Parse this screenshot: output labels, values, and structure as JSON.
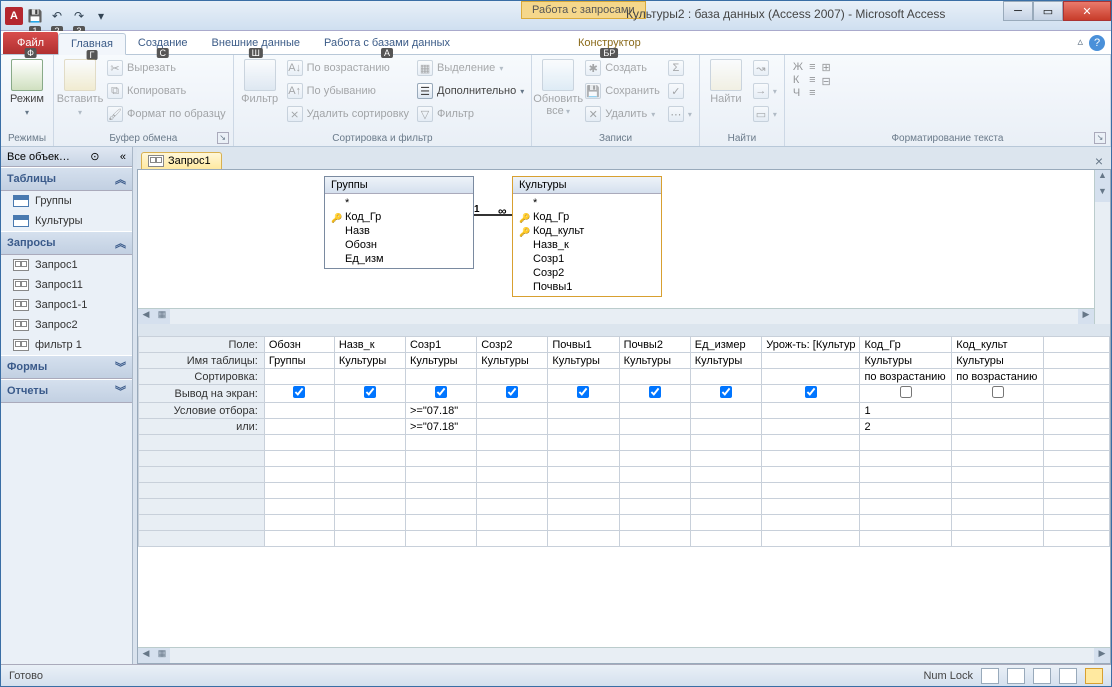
{
  "titlebar": {
    "context_tab": "Работа с запросами",
    "title": "Культуры2 : база данных (Access 2007)  -  Microsoft Access"
  },
  "qat_keytips": [
    "1",
    "2",
    "3"
  ],
  "ribbon_tabs": {
    "file": "Файл",
    "tabs": [
      {
        "label": "Главная",
        "key": "Г",
        "active": true
      },
      {
        "label": "Создание",
        "key": "С"
      },
      {
        "label": "Внешние данные",
        "key": "Ш"
      },
      {
        "label": "Работа с базами данных",
        "key": "А"
      },
      {
        "label": "Конструктор",
        "key": "БР",
        "context": true
      }
    ],
    "file_key": "Ф"
  },
  "ribbon": {
    "views": {
      "mode": "Режим",
      "group": "Режимы"
    },
    "clipboard": {
      "paste": "Вставить",
      "cut": "Вырезать",
      "copy": "Копировать",
      "fmt": "Формат по образцу",
      "group": "Буфер обмена"
    },
    "sort": {
      "filter": "Фильтр",
      "asc": "По возрастанию",
      "desc": "По убыванию",
      "clear": "Удалить сортировку",
      "sel": "Выделение",
      "adv": "Дополнительно",
      "toggle": "Фильтр",
      "group": "Сортировка и фильтр"
    },
    "records": {
      "refresh": "Обновить все",
      "new": "Создать",
      "save": "Сохранить",
      "delete": "Удалить",
      "totals": "Σ",
      "spell": "✓",
      "more": "⋯",
      "group": "Записи"
    },
    "find": {
      "find": "Найти",
      "replace": "↝",
      "goto": "→",
      "select": "▭",
      "group": "Найти"
    },
    "format": {
      "group": "Форматирование текста"
    }
  },
  "nav": {
    "header": "Все объек…",
    "cats": [
      {
        "title": "Таблицы",
        "items": [
          {
            "t": "tbl",
            "label": "Группы"
          },
          {
            "t": "tbl",
            "label": "Культуры"
          }
        ]
      },
      {
        "title": "Запросы",
        "items": [
          {
            "t": "qry",
            "label": "Запрос1"
          },
          {
            "t": "qry",
            "label": "Запрос11"
          },
          {
            "t": "qry",
            "label": "Запрос1-1"
          },
          {
            "t": "qry",
            "label": "Запрос2"
          },
          {
            "t": "qry",
            "label": "фильтр 1"
          }
        ]
      },
      {
        "title": "Формы",
        "items": []
      },
      {
        "title": "Отчеты",
        "items": []
      }
    ]
  },
  "doc": {
    "tab": "Запрос1"
  },
  "diagram": {
    "t1": {
      "title": "Группы",
      "fields": [
        "*",
        "Код_Гр",
        "Назв",
        "Обозн",
        "Ед_изм"
      ],
      "keys": [
        false,
        true,
        false,
        false,
        false
      ]
    },
    "t2": {
      "title": "Культуры",
      "fields": [
        "*",
        "Код_Гр",
        "Код_культ",
        "Назв_к",
        "Созр1",
        "Созр2",
        "Почвы1"
      ],
      "keys": [
        false,
        true,
        true,
        false,
        false,
        false,
        false
      ]
    },
    "rel": {
      "one": "1",
      "many": "∞"
    }
  },
  "grid": {
    "rows": [
      "Поле:",
      "Имя таблицы:",
      "Сортировка:",
      "Вывод на экран:",
      "Условие отбора:",
      "или:"
    ],
    "cols": [
      {
        "field": "Обозн",
        "table": "Группы",
        "sort": "",
        "show": true,
        "crit": "",
        "or": ""
      },
      {
        "field": "Назв_к",
        "table": "Культуры",
        "sort": "",
        "show": true,
        "crit": "",
        "or": ""
      },
      {
        "field": "Созр1",
        "table": "Культуры",
        "sort": "",
        "show": true,
        "crit": ">=\"07.18\"",
        "or": ">=\"07.18\""
      },
      {
        "field": "Созр2",
        "table": "Культуры",
        "sort": "",
        "show": true,
        "crit": "",
        "or": ""
      },
      {
        "field": "Почвы1",
        "table": "Культуры",
        "sort": "",
        "show": true,
        "crit": "",
        "or": ""
      },
      {
        "field": "Почвы2",
        "table": "Культуры",
        "sort": "",
        "show": true,
        "crit": "",
        "or": ""
      },
      {
        "field": "Ед_измер",
        "table": "Культуры",
        "sort": "",
        "show": true,
        "crit": "",
        "or": ""
      },
      {
        "field": "Урож-ть: [Культур",
        "table": "",
        "sort": "",
        "show": true,
        "crit": "",
        "or": ""
      },
      {
        "field": "Код_Гр",
        "table": "Культуры",
        "sort": "по возрастанию",
        "show": false,
        "crit": "1",
        "or": "2"
      },
      {
        "field": "Код_культ",
        "table": "Культуры",
        "sort": "по возрастанию",
        "show": false,
        "crit": "",
        "or": ""
      }
    ]
  },
  "status": {
    "ready": "Готово",
    "numlock": "Num Lock"
  }
}
